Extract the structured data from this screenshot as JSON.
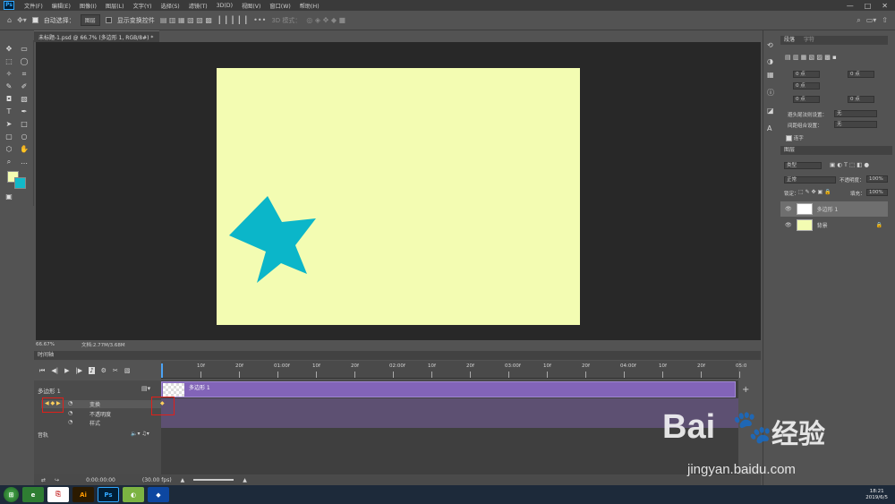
{
  "menubar": {
    "app_icon": "Ps",
    "items": [
      "文件(F)",
      "编辑(E)",
      "图像(I)",
      "图层(L)",
      "文字(Y)",
      "选择(S)",
      "滤镜(T)",
      "3D(D)",
      "视图(V)",
      "窗口(W)",
      "帮助(H)"
    ],
    "window_buttons": [
      "—",
      "□",
      "✕"
    ]
  },
  "options": {
    "auto_select_label": "自动选择：",
    "auto_select_value": "图层",
    "show_transform_label": "显示变换控件",
    "mode_3d_label": "3D 模式："
  },
  "document": {
    "tab_title": "未标题-1.psd @ 66.7% (多边形 1, RGB/8#) *",
    "artboard_color": "#f3fcb2",
    "star_color": "#0bb6c9"
  },
  "status": {
    "zoom": "66.67%",
    "doc_size": "文档:2.77M/3.68M"
  },
  "timeline": {
    "panel_title": "时间轴",
    "ruler_labels": [
      "10f",
      "20f",
      "01:00f",
      "10f",
      "20f",
      "02:00f",
      "10f",
      "20f",
      "03:00f",
      "10f",
      "20f",
      "04:00f",
      "10f",
      "20f",
      "05:0"
    ],
    "layer_track": "多边形 1",
    "clip_label": "多边形 1",
    "properties": [
      "变换",
      "不透明度",
      "样式"
    ],
    "audio_label": "音轨",
    "current_time": "0:00:00:00",
    "fps": "(30.00 fps)"
  },
  "character_panel": {
    "tabs": [
      "段落",
      "字符"
    ],
    "fields": [
      "0 点",
      "0 点",
      "0 点",
      "0 点",
      "0 点"
    ],
    "hyphen_label": "避头尾法则设置：",
    "hyphen_value": "无",
    "spacing_label": "间距组合设置：",
    "spacing_value": "无",
    "hyphenate_label": "连字"
  },
  "layers_panel": {
    "title": "图层",
    "filter_value": "类型",
    "blend_mode": "正常",
    "opacity_label": "不透明度：",
    "opacity_value": "100%",
    "lock_label": "锁定：",
    "fill_label": "填充：",
    "fill_value": "100%",
    "layers": [
      {
        "name": "多边形 1",
        "selected": true
      },
      {
        "name": "背景",
        "selected": false
      }
    ]
  },
  "taskbar": {
    "apps": [
      "Ie",
      "Pdf",
      "Ai",
      "Ps",
      "Gr",
      "Ml"
    ],
    "time": "18:21",
    "date": "2019/6/5"
  },
  "watermark": {
    "brand": "Bai",
    "brand2": "经验",
    "url": "jingyan.baidu.com"
  }
}
